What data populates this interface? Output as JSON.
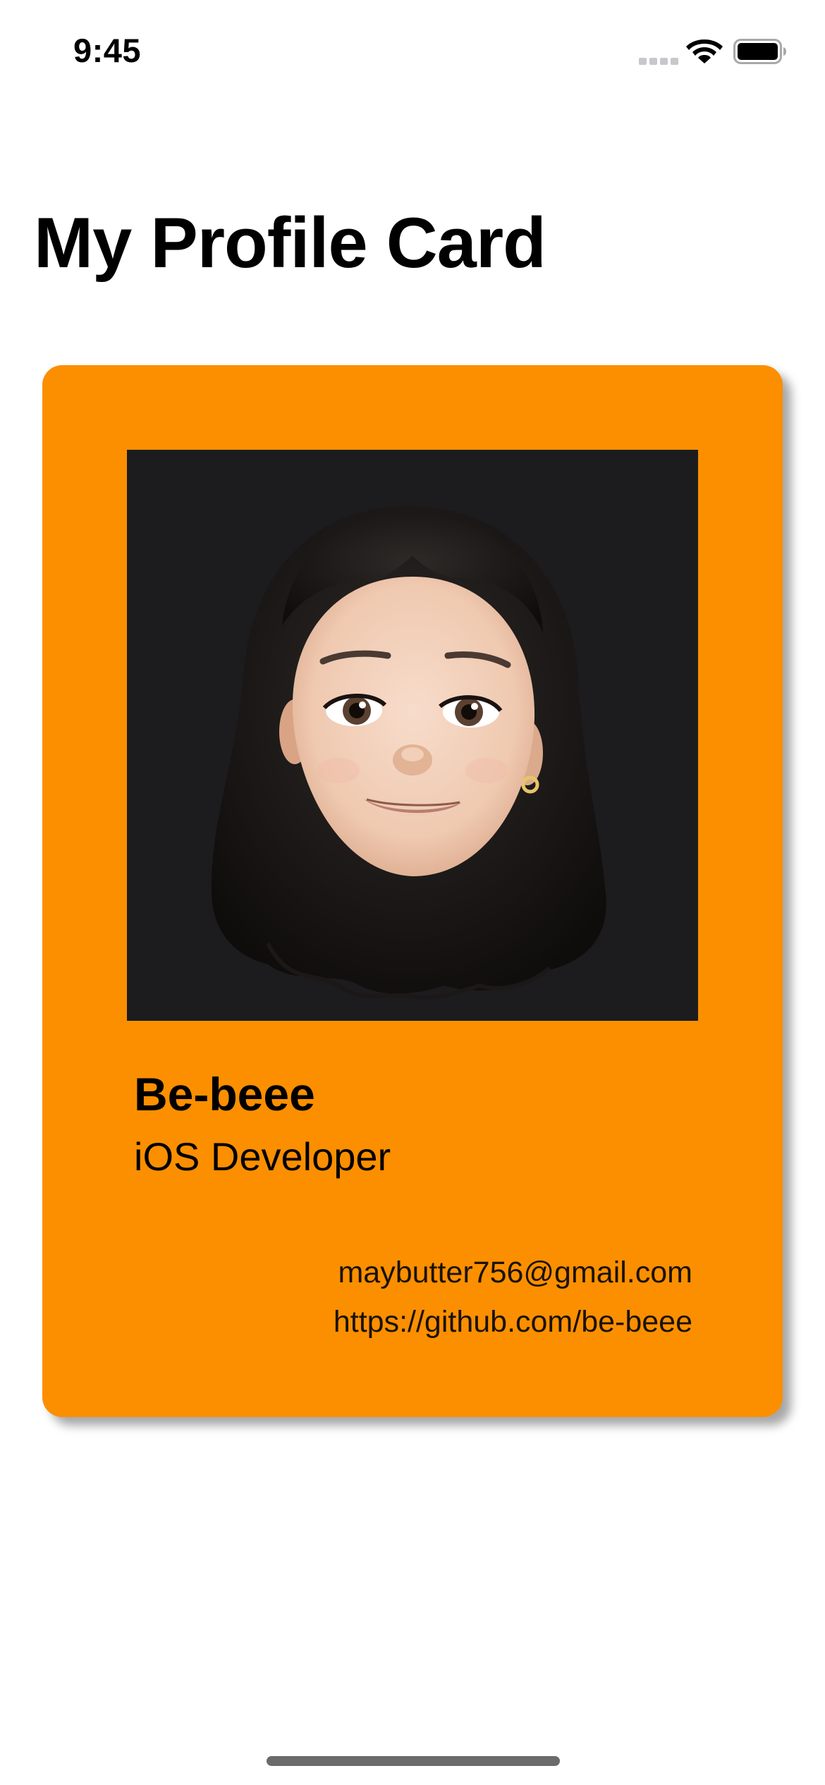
{
  "status_bar": {
    "time": "9:45",
    "icons": [
      "cellular-signal-icon",
      "wifi-icon",
      "battery-icon"
    ]
  },
  "page": {
    "title": "My Profile Card"
  },
  "card": {
    "background_color": "#FB8F00",
    "avatar": {
      "icon": "memoji-avatar-icon",
      "background_color": "#1C1C1E"
    },
    "name": "Be-beee",
    "role": "iOS Developer",
    "email": "maybutter756@gmail.com",
    "github": "https://github.com/be-beee"
  }
}
